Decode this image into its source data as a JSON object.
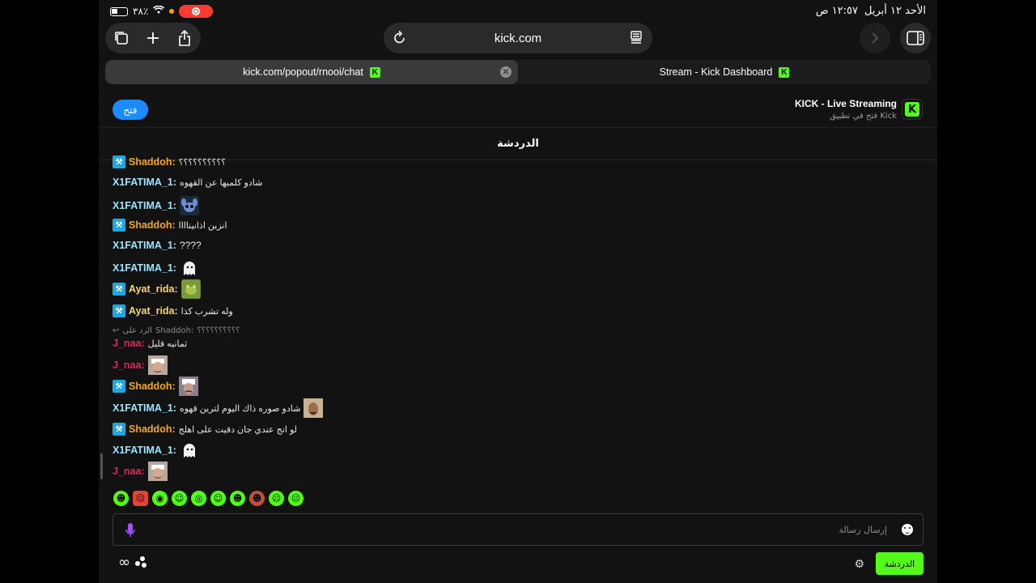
{
  "status": {
    "time": "١٢:٥٧ ص",
    "date": "الأحد ١٢ أبريل",
    "battery": "٣٨٪"
  },
  "toolbar": {
    "url": "kick.com"
  },
  "tabs": [
    {
      "label": "kick.com/popout/rnooi/chat",
      "active": true
    },
    {
      "label": "Stream - Kick Dashboard",
      "active": false
    }
  ],
  "banner": {
    "open_label": "فتح",
    "title": "KICK - Live Streaming",
    "subtitle": "فتح في تطبيق Kick"
  },
  "chat": {
    "title": "الدردشة",
    "messages": [
      {
        "user": "Shaddoh:",
        "text": "؟؟؟؟؟؟؟؟؟؟",
        "color": "#f5a623",
        "badge": true
      },
      {
        "user": "X1FATIMA_1:",
        "text": "شادو كلميها عن القهوه",
        "color": "#9ce5ff",
        "badge": false
      },
      {
        "user": "X1FATIMA_1:",
        "text": "",
        "color": "#9ce5ff",
        "badge": false,
        "emote": "stitch"
      },
      {
        "user": "Shaddoh:",
        "text": "انزين اذانيناااا",
        "color": "#f5a623",
        "badge": true
      },
      {
        "user": "X1FATIMA_1:",
        "text": "????",
        "color": "#9ce5ff",
        "badge": false
      },
      {
        "user": "X1FATIMA_1:",
        "text": "",
        "color": "#9ce5ff",
        "badge": false,
        "emote": "ghost"
      },
      {
        "user": "Ayat_rida:",
        "text": "",
        "color": "#f5d76e",
        "badge": true,
        "emote": "frog"
      },
      {
        "user": "Ayat_rida:",
        "text": "وله تشرب كذا",
        "color": "#f5d76e",
        "badge": true
      },
      {
        "user": "J_naa:",
        "text": "ثمانيه قليل",
        "color": "#e0245e",
        "badge": false
      },
      {
        "user": "J_naa:",
        "text": "",
        "color": "#e0245e",
        "badge": false,
        "emote": "face"
      },
      {
        "user": "Shaddoh:",
        "text": "",
        "color": "#f5a623",
        "badge": true,
        "emote": "face"
      },
      {
        "user": "X1FATIMA_1:",
        "text": "شادو صوره ذاك اليوم لترين قهوه",
        "color": "#9ce5ff",
        "badge": false,
        "emote": "face2"
      },
      {
        "user": "Shaddoh:",
        "text": "لو انج عندي جان دقيت على اهلج",
        "color": "#f5a623",
        "badge": true
      },
      {
        "user": "X1FATIMA_1:",
        "text": "",
        "color": "#9ce5ff",
        "badge": false,
        "emote": "ghost"
      },
      {
        "user": "J_naa:",
        "text": "",
        "color": "#e0245e",
        "badge": false,
        "emote": "face"
      }
    ],
    "reply": {
      "prefix": "الرد على",
      "target": "Shaddoh:",
      "snippet": "؟؟؟؟؟؟؟؟؟؟"
    },
    "input_placeholder": "إرسال رسالة",
    "send_label": "الدردشة"
  }
}
